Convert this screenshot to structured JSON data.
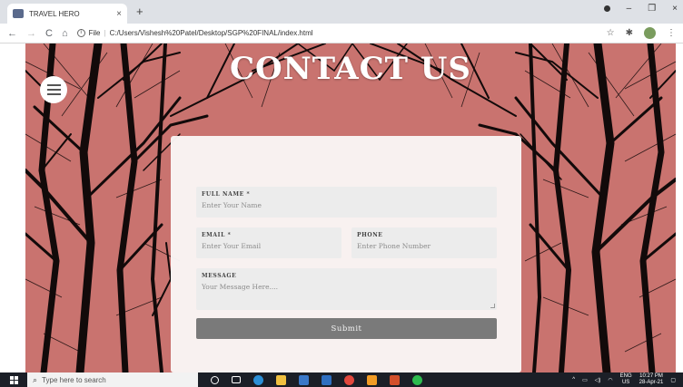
{
  "browser": {
    "tab_title": "TRAVEL HERO",
    "tab_close": "×",
    "new_tab": "+",
    "address_prefix": "File",
    "url": "C:/Users/Vishesh%20Patel/Desktop/SGP%20FINAL/index.html",
    "nav": {
      "back": "←",
      "forward": "→",
      "reload": "C",
      "home": "⌂"
    },
    "tools": {
      "star": "☆",
      "extension": "✱",
      "menu": "⋮"
    },
    "window": {
      "minimize": "–",
      "maximize": "❐",
      "close": "×"
    }
  },
  "page": {
    "title": "CONTACT US",
    "form": {
      "full_name": {
        "label": "FULL NAME *",
        "placeholder": "Enter Your Name"
      },
      "email": {
        "label": "EMAIL *",
        "placeholder": "Enter Your Email"
      },
      "phone": {
        "label": "PHONE",
        "placeholder": "Enter Phone Number"
      },
      "message": {
        "label": "MESSAGE",
        "placeholder": "Your Message Here...."
      },
      "submit_label": "Submit"
    }
  },
  "taskbar": {
    "search_placeholder": "Type here to search",
    "tray_lang_top": "ENG",
    "tray_lang_bottom": "US",
    "time": "10:27 PM",
    "date": "28-Apr-21",
    "tray_arrow": "^"
  },
  "colors": {
    "hero_bg": "#c9736f",
    "submit_bg": "#7a7a7a"
  }
}
